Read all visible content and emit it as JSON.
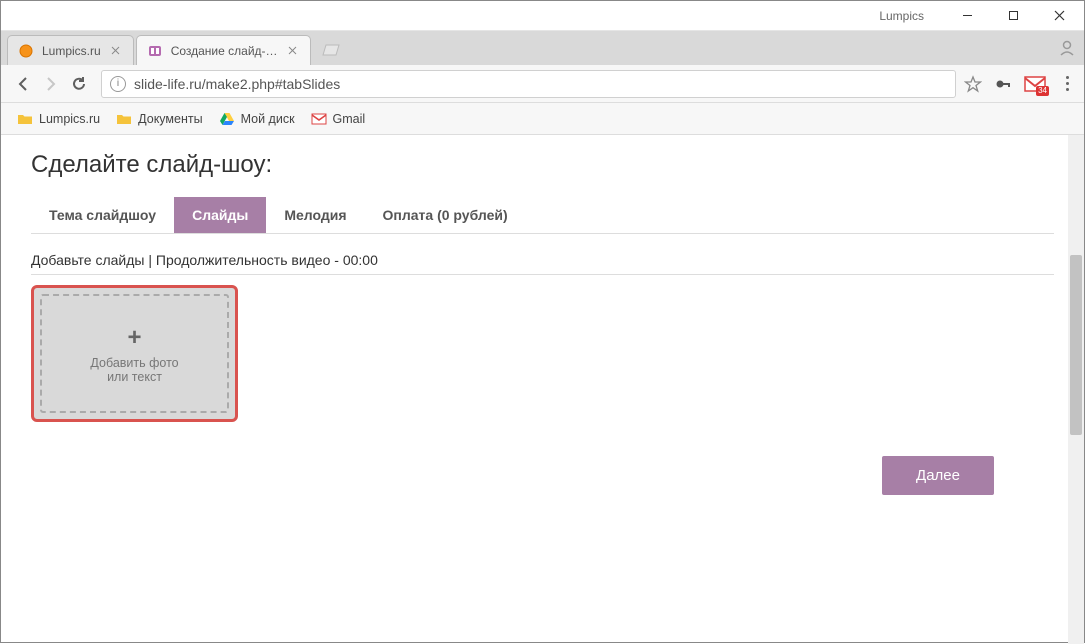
{
  "window": {
    "title": "Lumpics"
  },
  "browser": {
    "tabs": [
      {
        "title": "Lumpics.ru",
        "favicon": "orange-circle"
      },
      {
        "title": "Создание слайд-шоу —",
        "favicon": "slide-app"
      }
    ],
    "url": "slide-life.ru/make2.php#tabSlides",
    "gmail_badge": "34"
  },
  "bookmarks": [
    {
      "label": "Lumpics.ru",
      "icon": "folder"
    },
    {
      "label": "Документы",
      "icon": "folder"
    },
    {
      "label": "Мой диск",
      "icon": "drive"
    },
    {
      "label": "Gmail",
      "icon": "gmail"
    }
  ],
  "page": {
    "title": "Сделайте слайд-шоу:",
    "tabs": [
      {
        "label": "Тема слайдшоу"
      },
      {
        "label": "Слайды"
      },
      {
        "label": "Мелодия"
      },
      {
        "label": "Оплата (0 рублей)"
      }
    ],
    "active_tab_index": 1,
    "slides_hint": "Добавьте слайды | Продолжительность видео - 00:00",
    "add_slide": {
      "plus": "+",
      "line1": "Добавить фото",
      "line2": "или текст"
    },
    "next_label": "Далее"
  }
}
